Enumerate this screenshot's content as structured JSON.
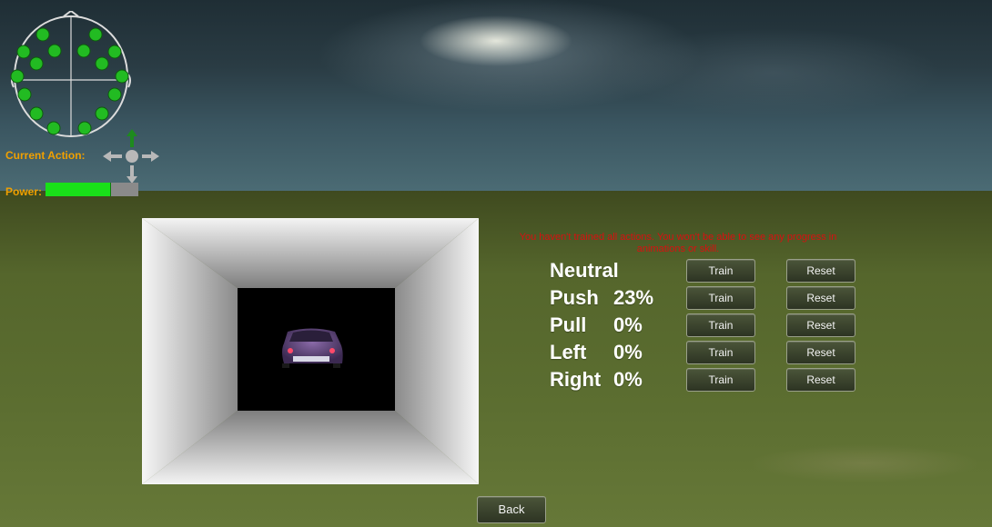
{
  "hud": {
    "current_action_label": "Current Action:",
    "power_label": "Power:",
    "power_level": 0.7,
    "electrode_color": "#22bb22",
    "arrow_up_color": "#1e8a1e"
  },
  "training": {
    "warning": "You haven't trained all actions. You won't be able to see any progress in animations or skill.",
    "actions": [
      {
        "name": "Neutral",
        "percent": "",
        "train_label": "Train",
        "reset_label": "Reset"
      },
      {
        "name": "Push",
        "percent": "23%",
        "train_label": "Train",
        "reset_label": "Reset"
      },
      {
        "name": "Pull",
        "percent": "0%",
        "train_label": "Train",
        "reset_label": "Reset"
      },
      {
        "name": "Left",
        "percent": "0%",
        "train_label": "Train",
        "reset_label": "Reset"
      },
      {
        "name": "Right",
        "percent": "0%",
        "train_label": "Train",
        "reset_label": "Reset"
      }
    ]
  },
  "footer": {
    "back_label": "Back"
  }
}
